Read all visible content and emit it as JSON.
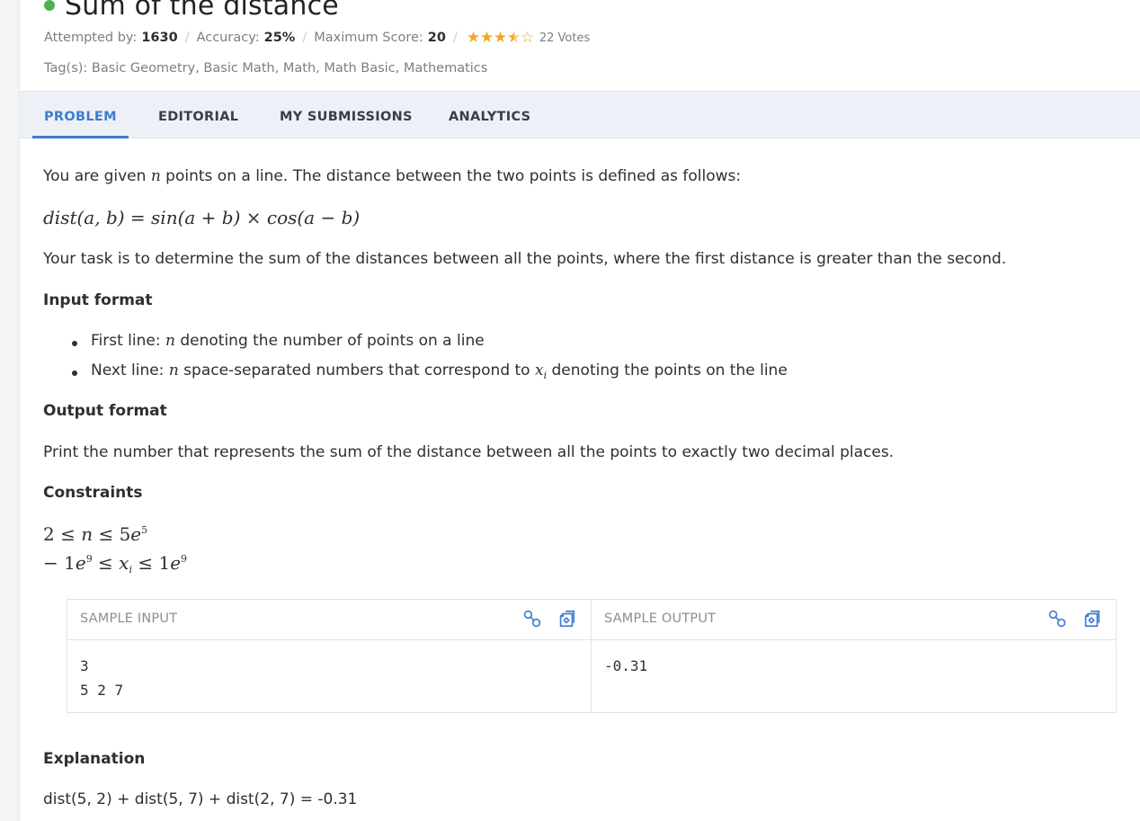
{
  "problem": {
    "title": "Sum of the distance",
    "status_color": "#4caf50"
  },
  "meta": {
    "attempted_label": "Attempted by:",
    "attempted_value": "1630",
    "accuracy_label": "Accuracy:",
    "accuracy_value": "25%",
    "max_score_label": "Maximum Score:",
    "max_score_value": "20",
    "rating": 3.5,
    "rating_max": 5,
    "votes": "22 Votes"
  },
  "tags": "Tag(s): Basic Geometry, Basic Math, Math, Math Basic, Mathematics",
  "tabs": [
    {
      "label": "PROBLEM",
      "active": true
    },
    {
      "label": "EDITORIAL",
      "active": false
    },
    {
      "label": "MY SUBMISSIONS",
      "active": false
    },
    {
      "label": "ANALYTICS",
      "active": false
    }
  ],
  "statement": {
    "intro_before": "You are given ",
    "intro_var": "n",
    "intro_after": " points on a line. The distance between the two points is defined as follows:",
    "formula_lhs": "dist(a, b)",
    "formula_eq": "=",
    "formula_rhs1": "sin(a + b)",
    "formula_times": "×",
    "formula_rhs2": "cos(a − b)",
    "task": "Your task is to determine the sum of the distances between all the points, where the first distance is greater than the second."
  },
  "input_format": {
    "heading": "Input format",
    "bullet1_before": "First line: ",
    "bullet1_var": "n",
    "bullet1_after": " denoting the number of points on a line",
    "bullet2_before": "Next line: ",
    "bullet2_var": "n",
    "bullet2_mid": " space-separated numbers that correspond to ",
    "bullet2_var2": "x",
    "bullet2_sub": "i",
    "bullet2_after": " denoting the points on the line"
  },
  "output_format": {
    "heading": "Output format",
    "text": "Print the number that represents the sum of the distance between all the points to exactly two decimal places."
  },
  "constraints": {
    "heading": "Constraints",
    "line1_a": "2 ≤ ",
    "line1_var": "n",
    "line1_b": " ≤ 5",
    "line1_e": "e",
    "line1_exp": "5",
    "line2_a": "− 1",
    "line2_e1": "e",
    "line2_exp1": "9",
    "line2_b": " ≤ ",
    "line2_var": "x",
    "line2_sub": "i",
    "line2_c": " ≤ 1",
    "line2_e2": "e",
    "line2_exp2": "9"
  },
  "sample": {
    "input_label": "SAMPLE INPUT",
    "output_label": "SAMPLE OUTPUT",
    "input_text": "3\n5 2 7",
    "output_text": "-0.31",
    "link_icon": "link-icon",
    "copy_icon": "copy-icon",
    "icon_color": "#3d7dd0"
  },
  "explanation": {
    "heading": "Explanation",
    "text": "dist(5, 2)  + dist(5, 7) + dist(2, 7) = -0.31"
  }
}
